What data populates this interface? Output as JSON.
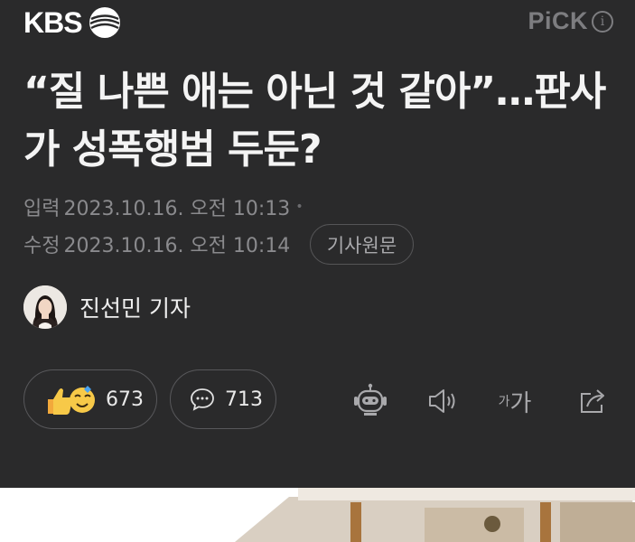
{
  "header": {
    "logo_text": "KBS",
    "pick_text": "PiCK",
    "info_glyph": "i"
  },
  "article": {
    "title": "“질 나쁜 애는 아닌 것 같아”…판사가 성폭행범 두둔?",
    "entered_label": "입력",
    "entered_time": "2023.10.16. 오전 10:13",
    "modified_label": "수정",
    "modified_time": "2023.10.16. 오전 10:14",
    "original_button": "기사원문",
    "author": "진선민 기자"
  },
  "actions": {
    "reactions_count": "673",
    "comments_count": "713",
    "font_small": "가",
    "font_big": "가"
  },
  "icons": {
    "logo": "kbs-logo-icon",
    "info": "info-icon",
    "reaction": "thumbs-up-emoji-icon",
    "comment": "comment-bubble-icon",
    "bot": "robot-icon",
    "speaker": "speaker-icon",
    "share": "share-icon"
  }
}
